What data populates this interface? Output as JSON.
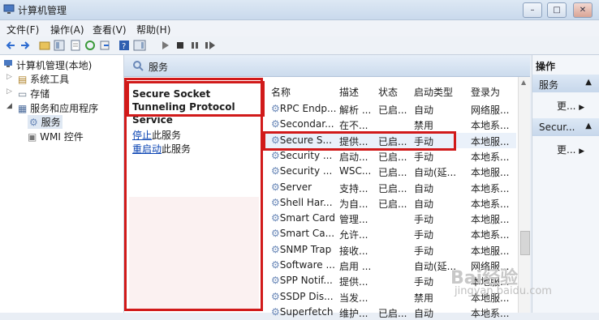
{
  "window": {
    "title": "计算机管理",
    "minimize": "–",
    "maximize": "□",
    "close": "✕"
  },
  "menu": [
    "文件(F)",
    "操作(A)",
    "查看(V)",
    "帮助(H)"
  ],
  "tree": {
    "root": "计算机管理(本地)",
    "items": [
      "系统工具",
      "存储",
      "服务和应用程序",
      "服务",
      "WMI 控件"
    ]
  },
  "center": {
    "header": "服务",
    "service_title": "Secure Socket Tunneling Protocol Service",
    "stop_link": "停止",
    "stop_text": "此服务",
    "restart_link": "重启动",
    "restart_text": "此服务"
  },
  "table": {
    "columns": [
      "名称",
      "描述",
      "状态",
      "启动类型",
      "登录为"
    ],
    "rows": [
      [
        "RPC Endp...",
        "解析 ...",
        "已启...",
        "自动",
        "网络服..."
      ],
      [
        "Secondar...",
        "在不...",
        "",
        "禁用",
        "本地系..."
      ],
      [
        "Secure S...",
        "提供...",
        "已启...",
        "手动",
        "本地服..."
      ],
      [
        "Security ...",
        "启动...",
        "已启...",
        "手动",
        "本地系..."
      ],
      [
        "Security ...",
        "WSC...",
        "已启...",
        "自动(延...",
        "本地服..."
      ],
      [
        "Server",
        "支持...",
        "已启...",
        "自动",
        "本地系..."
      ],
      [
        "Shell Har...",
        "为自...",
        "已启...",
        "自动",
        "本地系..."
      ],
      [
        "Smart Card",
        "管理...",
        "",
        "手动",
        "本地服..."
      ],
      [
        "Smart Ca...",
        "允许...",
        "",
        "手动",
        "本地系..."
      ],
      [
        "SNMP Trap",
        "接收...",
        "",
        "手动",
        "本地服..."
      ],
      [
        "Software ...",
        "启用 ...",
        "",
        "自动(延...",
        "网络服..."
      ],
      [
        "SPP Notif...",
        "提供...",
        "",
        "手动",
        "本地服..."
      ],
      [
        "SSDP Dis...",
        "当发...",
        "",
        "禁用",
        "本地服..."
      ],
      [
        "Superfetch",
        "维护...",
        "已启...",
        "自动",
        "本地系..."
      ]
    ]
  },
  "actions": {
    "title": "操作",
    "group1": "服务",
    "more1": "更...",
    "group2": "Secur...",
    "more2": "更..."
  },
  "watermark": {
    "main": "Bai经验",
    "sub": "jingyan.baidu.com"
  }
}
